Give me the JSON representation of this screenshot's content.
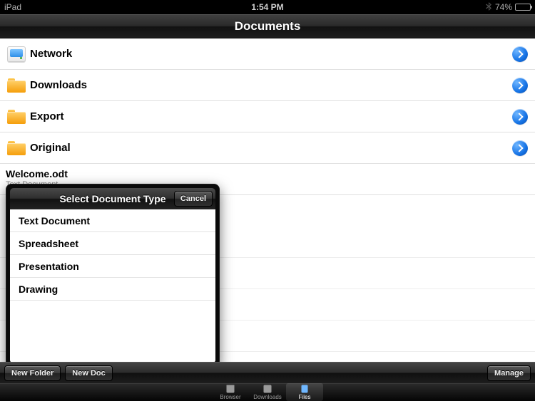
{
  "status": {
    "device": "iPad",
    "time": "1:54 PM",
    "battery_pct": "74%"
  },
  "app": {
    "title": "Documents"
  },
  "rows": [
    {
      "kind": "network",
      "label": "Network"
    },
    {
      "kind": "folder",
      "label": "Downloads"
    },
    {
      "kind": "folder",
      "label": "Export"
    },
    {
      "kind": "folder",
      "label": "Original"
    }
  ],
  "doc": {
    "name": "Welcome.odt",
    "subtitle": "Text Document"
  },
  "popover": {
    "title": "Select Document Type",
    "cancel": "Cancel",
    "items": [
      "Text Document",
      "Spreadsheet",
      "Presentation",
      "Drawing"
    ]
  },
  "toolbar": {
    "new_folder": "New Folder",
    "new_doc": "New Doc",
    "manage": "Manage"
  },
  "tabs": {
    "browser": "Browser",
    "downloads": "Downloads",
    "files": "Files",
    "active": "files"
  }
}
